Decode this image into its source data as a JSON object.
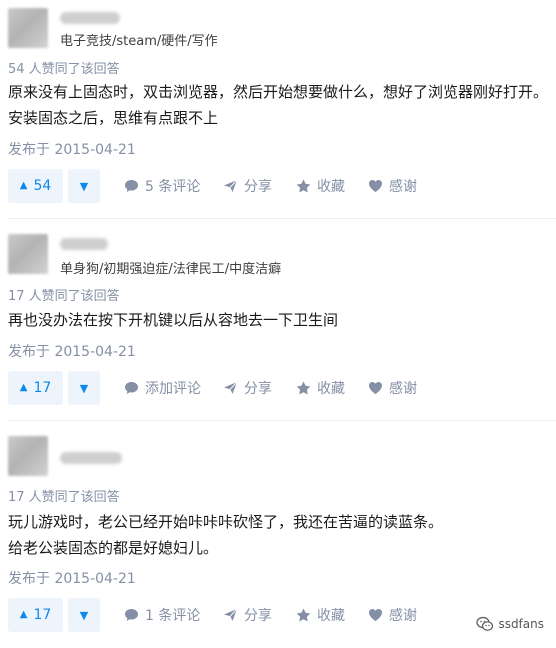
{
  "answers": [
    {
      "bio": "电子竞技/steam/硬件/写作",
      "votes_text": "54 人赞同了该回答",
      "lines": [
        "原来没有上固态时，双击浏览器，然后开始想要做什么，想好了浏览器刚好打开。",
        "安装固态之后，思维有点跟不上"
      ],
      "date": "发布于 2015-04-21",
      "vote_count": "54",
      "comment_label": "5 条评论",
      "share_label": "分享",
      "collect_label": "收藏",
      "thanks_label": "感谢"
    },
    {
      "bio": "单身狗/初期强迫症/法律民工/中度洁癖",
      "votes_text": "17 人赞同了该回答",
      "lines": [
        "再也没办法在按下开机键以后从容地去一下卫生间"
      ],
      "date": "发布于 2015-04-21",
      "vote_count": "17",
      "comment_label": "添加评论",
      "share_label": "分享",
      "collect_label": "收藏",
      "thanks_label": "感谢"
    },
    {
      "bio": "",
      "votes_text": "17 人赞同了该回答",
      "lines": [
        "玩儿游戏时，老公已经开始咔咔咔砍怪了，我还在苦逼的读蓝条。",
        "给老公装固态的都是好媳妇儿。"
      ],
      "date": "发布于 2015-04-21",
      "vote_count": "17",
      "comment_label": "1 条评论",
      "share_label": "分享",
      "collect_label": "收藏",
      "thanks_label": "感谢"
    }
  ],
  "watermark": {
    "text": "ssdfans"
  },
  "colors": {
    "accent": "#0f88eb",
    "meta": "#8590a6",
    "vote_bg": "#eef4fb"
  },
  "icons": [
    "vote-up-icon",
    "vote-down-icon",
    "comment-icon",
    "share-icon",
    "star-icon",
    "heart-icon",
    "wechat-icon"
  ]
}
